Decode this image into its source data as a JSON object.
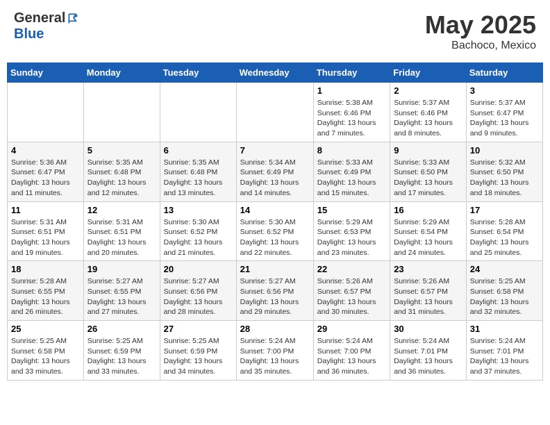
{
  "header": {
    "logo_general": "General",
    "logo_blue": "Blue",
    "month": "May 2025",
    "location": "Bachoco, Mexico"
  },
  "days_of_week": [
    "Sunday",
    "Monday",
    "Tuesday",
    "Wednesday",
    "Thursday",
    "Friday",
    "Saturday"
  ],
  "weeks": [
    [
      {
        "day": "",
        "content": ""
      },
      {
        "day": "",
        "content": ""
      },
      {
        "day": "",
        "content": ""
      },
      {
        "day": "",
        "content": ""
      },
      {
        "day": "1",
        "content": "Sunrise: 5:38 AM\nSunset: 6:46 PM\nDaylight: 13 hours\nand 7 minutes."
      },
      {
        "day": "2",
        "content": "Sunrise: 5:37 AM\nSunset: 6:46 PM\nDaylight: 13 hours\nand 8 minutes."
      },
      {
        "day": "3",
        "content": "Sunrise: 5:37 AM\nSunset: 6:47 PM\nDaylight: 13 hours\nand 9 minutes."
      }
    ],
    [
      {
        "day": "4",
        "content": "Sunrise: 5:36 AM\nSunset: 6:47 PM\nDaylight: 13 hours\nand 11 minutes."
      },
      {
        "day": "5",
        "content": "Sunrise: 5:35 AM\nSunset: 6:48 PM\nDaylight: 13 hours\nand 12 minutes."
      },
      {
        "day": "6",
        "content": "Sunrise: 5:35 AM\nSunset: 6:48 PM\nDaylight: 13 hours\nand 13 minutes."
      },
      {
        "day": "7",
        "content": "Sunrise: 5:34 AM\nSunset: 6:49 PM\nDaylight: 13 hours\nand 14 minutes."
      },
      {
        "day": "8",
        "content": "Sunrise: 5:33 AM\nSunset: 6:49 PM\nDaylight: 13 hours\nand 15 minutes."
      },
      {
        "day": "9",
        "content": "Sunrise: 5:33 AM\nSunset: 6:50 PM\nDaylight: 13 hours\nand 17 minutes."
      },
      {
        "day": "10",
        "content": "Sunrise: 5:32 AM\nSunset: 6:50 PM\nDaylight: 13 hours\nand 18 minutes."
      }
    ],
    [
      {
        "day": "11",
        "content": "Sunrise: 5:31 AM\nSunset: 6:51 PM\nDaylight: 13 hours\nand 19 minutes."
      },
      {
        "day": "12",
        "content": "Sunrise: 5:31 AM\nSunset: 6:51 PM\nDaylight: 13 hours\nand 20 minutes."
      },
      {
        "day": "13",
        "content": "Sunrise: 5:30 AM\nSunset: 6:52 PM\nDaylight: 13 hours\nand 21 minutes."
      },
      {
        "day": "14",
        "content": "Sunrise: 5:30 AM\nSunset: 6:52 PM\nDaylight: 13 hours\nand 22 minutes."
      },
      {
        "day": "15",
        "content": "Sunrise: 5:29 AM\nSunset: 6:53 PM\nDaylight: 13 hours\nand 23 minutes."
      },
      {
        "day": "16",
        "content": "Sunrise: 5:29 AM\nSunset: 6:54 PM\nDaylight: 13 hours\nand 24 minutes."
      },
      {
        "day": "17",
        "content": "Sunrise: 5:28 AM\nSunset: 6:54 PM\nDaylight: 13 hours\nand 25 minutes."
      }
    ],
    [
      {
        "day": "18",
        "content": "Sunrise: 5:28 AM\nSunset: 6:55 PM\nDaylight: 13 hours\nand 26 minutes."
      },
      {
        "day": "19",
        "content": "Sunrise: 5:27 AM\nSunset: 6:55 PM\nDaylight: 13 hours\nand 27 minutes."
      },
      {
        "day": "20",
        "content": "Sunrise: 5:27 AM\nSunset: 6:56 PM\nDaylight: 13 hours\nand 28 minutes."
      },
      {
        "day": "21",
        "content": "Sunrise: 5:27 AM\nSunset: 6:56 PM\nDaylight: 13 hours\nand 29 minutes."
      },
      {
        "day": "22",
        "content": "Sunrise: 5:26 AM\nSunset: 6:57 PM\nDaylight: 13 hours\nand 30 minutes."
      },
      {
        "day": "23",
        "content": "Sunrise: 5:26 AM\nSunset: 6:57 PM\nDaylight: 13 hours\nand 31 minutes."
      },
      {
        "day": "24",
        "content": "Sunrise: 5:25 AM\nSunset: 6:58 PM\nDaylight: 13 hours\nand 32 minutes."
      }
    ],
    [
      {
        "day": "25",
        "content": "Sunrise: 5:25 AM\nSunset: 6:58 PM\nDaylight: 13 hours\nand 33 minutes."
      },
      {
        "day": "26",
        "content": "Sunrise: 5:25 AM\nSunset: 6:59 PM\nDaylight: 13 hours\nand 33 minutes."
      },
      {
        "day": "27",
        "content": "Sunrise: 5:25 AM\nSunset: 6:59 PM\nDaylight: 13 hours\nand 34 minutes."
      },
      {
        "day": "28",
        "content": "Sunrise: 5:24 AM\nSunset: 7:00 PM\nDaylight: 13 hours\nand 35 minutes."
      },
      {
        "day": "29",
        "content": "Sunrise: 5:24 AM\nSunset: 7:00 PM\nDaylight: 13 hours\nand 36 minutes."
      },
      {
        "day": "30",
        "content": "Sunrise: 5:24 AM\nSunset: 7:01 PM\nDaylight: 13 hours\nand 36 minutes."
      },
      {
        "day": "31",
        "content": "Sunrise: 5:24 AM\nSunset: 7:01 PM\nDaylight: 13 hours\nand 37 minutes."
      }
    ]
  ]
}
